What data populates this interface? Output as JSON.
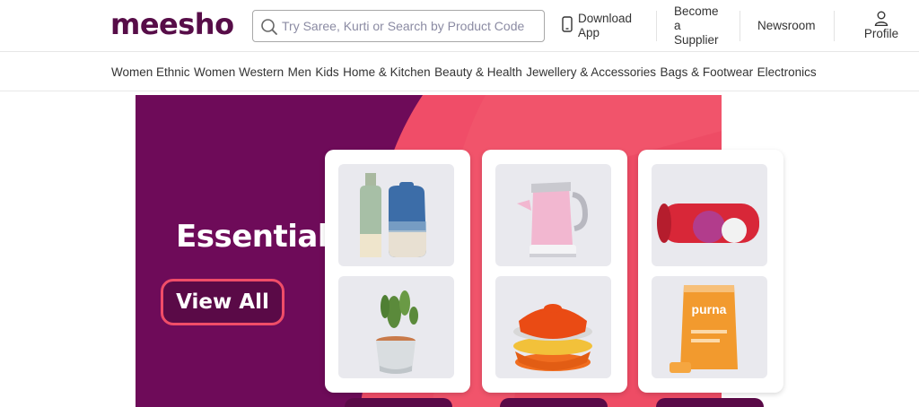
{
  "header": {
    "logo": "meesho",
    "search_placeholder": "Try Saree, Kurti or Search by Product Code",
    "download_app": "Download App",
    "become_supplier": "Become a Supplier",
    "newsroom": "Newsroom",
    "profile": "Profile"
  },
  "categories": [
    "Women Ethnic",
    "Women Western",
    "Men",
    "Kids",
    "Home & Kitchen",
    "Beauty & Health",
    "Jewellery & Accessories",
    "Bags & Footwear",
    "Electronics"
  ],
  "banner": {
    "title": "Essentials",
    "cta": "View All",
    "product_tiles": [
      {
        "name": "vases"
      },
      {
        "name": "potted-cactus"
      },
      {
        "name": "pink-electric-kettle"
      },
      {
        "name": "ceramic-bowls"
      },
      {
        "name": "foam-roller"
      },
      {
        "name": "supplement-pouch",
        "label": "purna"
      }
    ]
  },
  "colors": {
    "brand": "#570d48",
    "banner_purple": "#6e0b59",
    "banner_pink": "#f04d68",
    "cta_border": "#f04d68"
  }
}
